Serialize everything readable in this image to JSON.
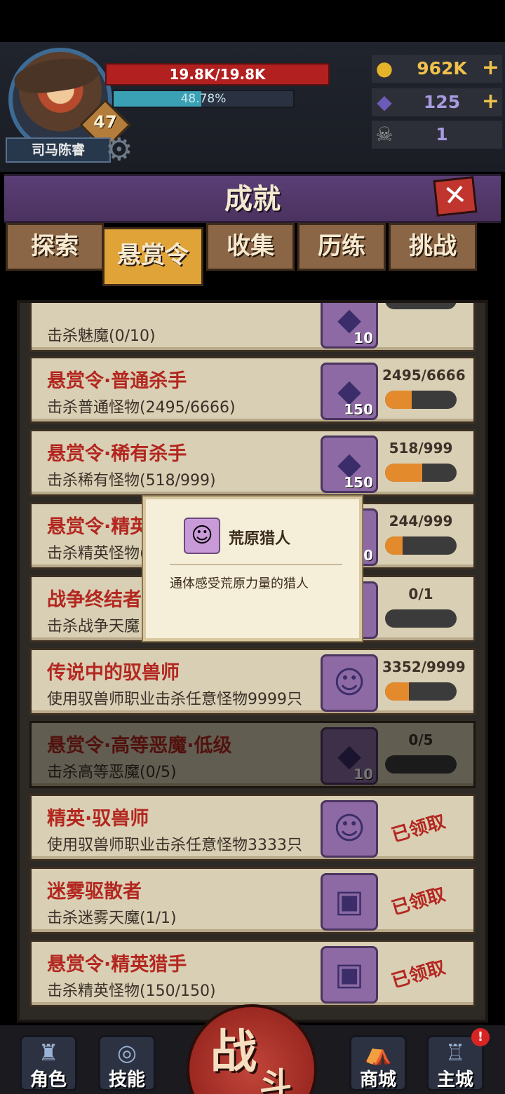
{
  "player": {
    "name": "司马陈睿",
    "level": "47",
    "hp": "19.8K/19.8K",
    "exp_text": "48.78%",
    "exp_fraction": 0.4878
  },
  "resources": {
    "gold": "962K",
    "gems": "125",
    "skulls": "1"
  },
  "window": {
    "title": "成就"
  },
  "tabs": [
    {
      "label": "探索"
    },
    {
      "label": "悬赏令"
    },
    {
      "label": "收集"
    },
    {
      "label": "历练"
    },
    {
      "label": "挑战"
    }
  ],
  "rows": [
    {
      "title": "",
      "desc": "击杀魅魔(0/10)",
      "reward": "10",
      "progress": "",
      "fill": 0
    },
    {
      "title": "悬赏令·普通杀手",
      "desc": "击杀普通怪物(2495/6666)",
      "reward": "150",
      "progress": "2495/6666",
      "fill": 0.374
    },
    {
      "title": "悬赏令·稀有杀手",
      "desc": "击杀稀有怪物(518/999)",
      "reward": "150",
      "progress": "518/999",
      "fill": 0.518
    },
    {
      "title": "悬赏令·精英",
      "desc": "击杀精英怪物(",
      "reward": "50",
      "progress": "244/999",
      "fill": 0.244
    },
    {
      "title": "战争终结者",
      "desc": "击杀战争天魔",
      "reward": "",
      "progress": "0/1",
      "fill": 0
    },
    {
      "title": "传说中的驭兽师",
      "desc": "使用驭兽师职业击杀任意怪物9999只",
      "reward": "",
      "progress": "3352/9999",
      "fill": 0.335
    },
    {
      "title": "悬赏令·高等恶魔·低级",
      "desc": "击杀高等恶魔(0/5)",
      "reward": "10",
      "progress": "0/5",
      "fill": 0
    },
    {
      "title": "精英·驭兽师",
      "desc": "使用驭兽师职业击杀任意怪物3333只",
      "reward": "",
      "claimed": "已领取"
    },
    {
      "title": "迷雾驱散者",
      "desc": "击杀迷雾天魔(1/1)",
      "reward": "",
      "claimed": "已领取"
    },
    {
      "title": "悬赏令·精英猎手",
      "desc": "击杀精英怪物(150/150)",
      "reward": "",
      "claimed": "已领取"
    }
  ],
  "tooltip": {
    "title": "荒原猎人",
    "desc": "通体感受荒原力量的猎人"
  },
  "nav": {
    "role": "角色",
    "skill": "技能",
    "battle_1": "战",
    "battle_2": "斗",
    "shop": "商城",
    "city": "主城",
    "alert": "!"
  },
  "colors": {
    "title_red": "#b32720",
    "gold": "#f0c24b",
    "tab_active": "#e0a338",
    "hp": "#b22020"
  }
}
